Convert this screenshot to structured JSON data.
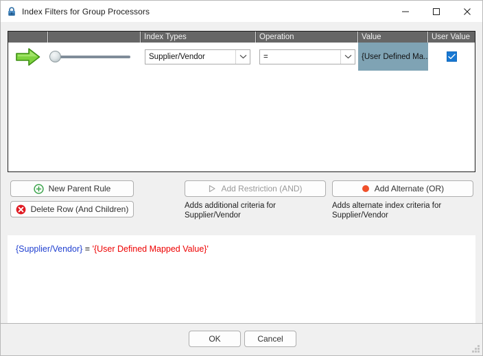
{
  "window": {
    "title": "Index Filters for Group Processors",
    "icon": "lock-icon",
    "minimize_label": "—",
    "maximize_label": "□",
    "close_label": "✕"
  },
  "grid": {
    "columns": [
      {
        "key": "arrow",
        "label": ""
      },
      {
        "key": "indent",
        "label": ""
      },
      {
        "key": "index_types",
        "label": "Index Types"
      },
      {
        "key": "operation",
        "label": "Operation"
      },
      {
        "key": "value",
        "label": "Value"
      },
      {
        "key": "user_value",
        "label": "User Value"
      }
    ],
    "rows": [
      {
        "row_icon": "green-arrow-icon",
        "indent_slider": {
          "value": 0,
          "min": 0,
          "max": 100
        },
        "index_type": "Supplier/Vendor",
        "operation": "=",
        "value": "{User Defined Ma...",
        "value_full": "{User Defined Mapped Value}",
        "value_selected": true,
        "user_value_checked": true
      }
    ]
  },
  "buttons": {
    "new_parent_rule": {
      "label": "New Parent Rule",
      "icon": "plus-circle-icon"
    },
    "delete_row": {
      "label": "Delete Row (And Children)",
      "icon": "delete-circle-icon"
    },
    "add_restriction": {
      "label": "Add Restriction (AND)",
      "icon": "play-triangle-icon",
      "enabled": false
    },
    "add_alternate": {
      "label": "Add Alternate (OR)",
      "icon": "orange-dot-icon",
      "enabled": true
    }
  },
  "hints": {
    "add_restriction": "Adds additional criteria for Supplier/Vendor",
    "add_alternate": "Adds alternate index criteria for Supplier/Vendor"
  },
  "formula": {
    "field": "{Supplier/Vendor}",
    "operator": "=",
    "value": "'{User Defined Mapped Value}'"
  },
  "footer": {
    "ok_label": "OK",
    "cancel_label": "Cancel"
  },
  "colors": {
    "header_bg": "#666666",
    "selected_cell": "#7fa3b4",
    "checkbox_blue": "#1878d2",
    "formula_field": "#1f3fd0",
    "formula_value": "#ee0000",
    "accent_green": "#66cc33",
    "accent_orange": "#f04c23"
  }
}
